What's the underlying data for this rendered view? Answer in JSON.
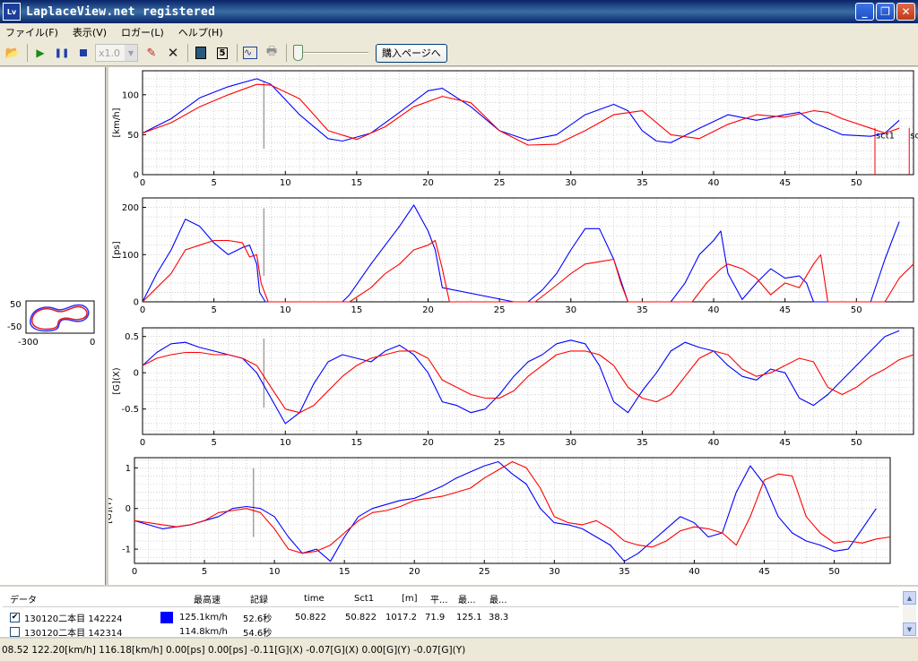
{
  "window": {
    "title": "LaplaceView.net registered",
    "icon_label": "Lv"
  },
  "menu": [
    "ファイル(F)",
    "表示(V)",
    "ロガー(L)",
    "ヘルプ(H)"
  ],
  "toolbar": {
    "speed_value": "x1.0",
    "buy_button": "購入ページへ",
    "playback_position": 0
  },
  "minimap": {
    "y_ticks": [
      "50",
      "-50"
    ],
    "x_ticks": [
      "-300",
      "0"
    ]
  },
  "colors": {
    "series1": "#0000ff",
    "series2": "#ff0000",
    "cursor": "#a0a0a0",
    "grid": "#b8b8b8"
  },
  "chart_data": [
    {
      "type": "line",
      "ylabel": "[km/h]",
      "ylim": [
        0,
        130
      ],
      "yticks": [
        "0",
        "50",
        "100"
      ],
      "xlim": [
        0,
        54
      ],
      "xticks": [
        "0",
        "5",
        "10",
        "15",
        "20",
        "25",
        "30",
        "35",
        "40",
        "45",
        "50"
      ],
      "cursor_x": 8.5,
      "annotations": [
        {
          "text": "sct1",
          "x": 51.3
        },
        {
          "text": "sct",
          "x": 53.7
        }
      ],
      "series": [
        {
          "x": [
            0,
            2,
            4,
            6,
            8,
            9,
            11,
            13,
            14,
            16,
            18,
            20,
            21,
            23,
            25,
            27,
            29,
            31,
            33,
            34,
            35,
            36,
            37,
            39,
            41,
            43,
            45,
            46,
            47,
            49,
            51,
            52,
            53
          ],
          "values": [
            52,
            70,
            96,
            110,
            120,
            113,
            75,
            45,
            42,
            52,
            78,
            105,
            108,
            85,
            55,
            43,
            50,
            75,
            88,
            80,
            55,
            42,
            40,
            58,
            75,
            68,
            75,
            78,
            65,
            50,
            48,
            52,
            68
          ]
        },
        {
          "x": [
            0,
            2,
            4,
            6,
            8,
            9,
            11,
            13,
            15,
            17,
            19,
            21,
            23,
            25,
            27,
            29,
            31,
            33,
            35,
            37,
            39,
            41,
            43,
            45,
            47,
            48,
            49,
            51,
            52,
            53
          ],
          "values": [
            52,
            65,
            85,
            100,
            113,
            112,
            95,
            55,
            44,
            60,
            85,
            98,
            90,
            55,
            37,
            38,
            55,
            75,
            80,
            50,
            45,
            63,
            75,
            72,
            80,
            78,
            70,
            58,
            52,
            58
          ]
        }
      ]
    },
    {
      "type": "line",
      "ylabel": "[ps]",
      "ylim": [
        0,
        220
      ],
      "yticks": [
        "0",
        "100",
        "200"
      ],
      "xlim": [
        0,
        54
      ],
      "xticks": [
        "0",
        "5",
        "10",
        "15",
        "20",
        "25",
        "30",
        "35",
        "40",
        "45",
        "50"
      ],
      "cursor_x": 8.5,
      "series": [
        {
          "x": [
            0,
            1,
            2,
            3,
            4,
            5,
            6,
            7,
            7.5,
            8,
            8.2,
            8.6,
            14,
            14.5,
            16,
            17,
            18,
            19,
            20,
            20.5,
            21,
            26,
            27,
            28,
            29,
            30,
            31,
            32,
            33,
            34,
            37,
            38,
            39,
            40,
            40.5,
            41,
            42,
            43,
            44,
            45,
            46,
            46.5,
            47,
            48,
            51,
            52,
            53
          ],
          "values": [
            0,
            60,
            110,
            175,
            160,
            125,
            100,
            115,
            120,
            80,
            20,
            0,
            0,
            15,
            80,
            120,
            160,
            205,
            150,
            110,
            30,
            0,
            0,
            25,
            60,
            110,
            155,
            155,
            90,
            0,
            0,
            40,
            100,
            130,
            150,
            60,
            5,
            40,
            70,
            50,
            55,
            40,
            0,
            0,
            0,
            90,
            170
          ]
        },
        {
          "x": [
            0,
            1,
            2,
            3,
            4,
            5,
            6,
            7,
            7.5,
            8,
            8.3,
            8.8,
            14.5,
            16,
            17,
            18,
            19,
            20,
            20.5,
            21,
            21.5,
            27.5,
            29,
            30,
            31,
            32,
            33,
            33.5,
            34,
            38.5,
            39.5,
            40.5,
            41,
            42,
            43,
            44,
            45,
            46,
            47,
            47.5,
            48,
            52,
            53,
            54
          ],
          "values": [
            0,
            30,
            60,
            110,
            120,
            130,
            130,
            125,
            95,
            100,
            40,
            0,
            0,
            30,
            60,
            80,
            110,
            120,
            130,
            70,
            0,
            0,
            35,
            60,
            80,
            85,
            90,
            40,
            0,
            0,
            40,
            70,
            80,
            70,
            50,
            15,
            40,
            30,
            80,
            100,
            0,
            0,
            50,
            80
          ]
        }
      ]
    },
    {
      "type": "line",
      "ylabel": "[G](X)",
      "ylim": [
        -0.85,
        0.62
      ],
      "yticks": [
        "-0.5",
        "0",
        "0.5"
      ],
      "xlim": [
        0,
        54
      ],
      "xticks": [
        "0",
        "5",
        "10",
        "15",
        "20",
        "25",
        "30",
        "35",
        "40",
        "45",
        "50"
      ],
      "cursor_x": 8.5,
      "series": [
        {
          "x": [
            0,
            1,
            2,
            3,
            4,
            5,
            6,
            7,
            8,
            9,
            10,
            11,
            12,
            13,
            14,
            15,
            16,
            17,
            18,
            19,
            20,
            21,
            22,
            23,
            24,
            25,
            26,
            27,
            28,
            29,
            30,
            31,
            32,
            33,
            34,
            35,
            36,
            37,
            38,
            39,
            40,
            41,
            42,
            43,
            44,
            45,
            46,
            47,
            48,
            49,
            50,
            51,
            52,
            53
          ],
          "values": [
            0.1,
            0.28,
            0.4,
            0.42,
            0.35,
            0.3,
            0.25,
            0.2,
            0.0,
            -0.35,
            -0.7,
            -0.55,
            -0.15,
            0.15,
            0.25,
            0.2,
            0.15,
            0.3,
            0.38,
            0.25,
            0.0,
            -0.4,
            -0.45,
            -0.55,
            -0.5,
            -0.3,
            -0.05,
            0.15,
            0.25,
            0.4,
            0.45,
            0.4,
            0.1,
            -0.4,
            -0.55,
            -0.25,
            0.0,
            0.3,
            0.42,
            0.35,
            0.3,
            0.1,
            -0.05,
            -0.1,
            0.05,
            0.0,
            -0.35,
            -0.45,
            -0.3,
            -0.1,
            0.1,
            0.3,
            0.5,
            0.58
          ]
        },
        {
          "x": [
            0,
            1,
            2,
            3,
            4,
            5,
            6,
            7,
            8,
            9,
            10,
            11,
            12,
            13,
            14,
            15,
            16,
            17,
            18,
            19,
            20,
            21,
            22,
            23,
            24,
            25,
            26,
            27,
            28,
            29,
            30,
            31,
            32,
            33,
            34,
            35,
            36,
            37,
            38,
            39,
            40,
            41,
            42,
            43,
            44,
            45,
            46,
            47,
            48,
            49,
            50,
            51,
            52,
            53,
            54
          ],
          "values": [
            0.1,
            0.2,
            0.25,
            0.28,
            0.28,
            0.25,
            0.25,
            0.2,
            0.1,
            -0.2,
            -0.5,
            -0.55,
            -0.45,
            -0.25,
            -0.05,
            0.1,
            0.2,
            0.25,
            0.3,
            0.3,
            0.2,
            -0.1,
            -0.2,
            -0.3,
            -0.35,
            -0.35,
            -0.25,
            -0.05,
            0.1,
            0.25,
            0.3,
            0.3,
            0.25,
            0.1,
            -0.2,
            -0.35,
            -0.4,
            -0.3,
            -0.05,
            0.2,
            0.3,
            0.25,
            0.05,
            -0.05,
            0.0,
            0.1,
            0.2,
            0.15,
            -0.2,
            -0.3,
            -0.2,
            -0.05,
            0.05,
            0.18,
            0.25
          ]
        }
      ]
    },
    {
      "type": "line",
      "ylabel": "[G](Y)",
      "ylim": [
        -1.35,
        1.25
      ],
      "yticks": [
        "-1",
        "0",
        "1"
      ],
      "xlim": [
        0,
        54
      ],
      "xticks": [
        "0",
        "5",
        "10",
        "15",
        "20",
        "25",
        "30",
        "35",
        "40",
        "45",
        "50"
      ],
      "cursor_x": 8.5,
      "series": [
        {
          "x": [
            0,
            1,
            2,
            3,
            4,
            5,
            6,
            7,
            8,
            9,
            10,
            11,
            12,
            13,
            14,
            15,
            16,
            17,
            18,
            19,
            20,
            21,
            22,
            23,
            24,
            25,
            26,
            27,
            28,
            29,
            30,
            31,
            32,
            33,
            34,
            35,
            36,
            37,
            38,
            39,
            40,
            41,
            42,
            43,
            44,
            45,
            46,
            47,
            48,
            49,
            50,
            51,
            52,
            53
          ],
          "values": [
            -0.3,
            -0.4,
            -0.5,
            -0.45,
            -0.4,
            -0.3,
            -0.2,
            0.0,
            0.05,
            0.0,
            -0.2,
            -0.7,
            -1.1,
            -1.0,
            -1.3,
            -0.7,
            -0.2,
            0.0,
            0.1,
            0.2,
            0.25,
            0.4,
            0.55,
            0.75,
            0.9,
            1.05,
            1.15,
            0.85,
            0.6,
            0.0,
            -0.35,
            -0.4,
            -0.5,
            -0.7,
            -0.9,
            -1.3,
            -1.1,
            -0.8,
            -0.5,
            -0.2,
            -0.35,
            -0.7,
            -0.6,
            0.4,
            1.05,
            0.6,
            -0.2,
            -0.6,
            -0.8,
            -0.9,
            -1.05,
            -1.0,
            -0.5,
            0.0
          ]
        },
        {
          "x": [
            0,
            1,
            2,
            3,
            4,
            5,
            6,
            7,
            8,
            9,
            10,
            11,
            12,
            13,
            14,
            15,
            16,
            17,
            18,
            19,
            20,
            21,
            22,
            23,
            24,
            25,
            26,
            27,
            28,
            29,
            30,
            31,
            32,
            33,
            34,
            35,
            36,
            37,
            38,
            39,
            40,
            41,
            42,
            43,
            44,
            45,
            46,
            47,
            48,
            49,
            50,
            51,
            52,
            53,
            54
          ],
          "values": [
            -0.3,
            -0.35,
            -0.4,
            -0.45,
            -0.4,
            -0.3,
            -0.1,
            -0.05,
            0.0,
            -0.1,
            -0.5,
            -1.0,
            -1.1,
            -1.05,
            -0.9,
            -0.6,
            -0.3,
            -0.1,
            -0.05,
            0.05,
            0.2,
            0.25,
            0.3,
            0.4,
            0.5,
            0.75,
            0.95,
            1.15,
            1.0,
            0.5,
            -0.2,
            -0.35,
            -0.4,
            -0.3,
            -0.5,
            -0.8,
            -0.9,
            -0.95,
            -0.8,
            -0.55,
            -0.45,
            -0.5,
            -0.6,
            -0.9,
            -0.2,
            0.7,
            0.85,
            0.8,
            -0.2,
            -0.6,
            -0.85,
            -0.8,
            -0.85,
            -0.75,
            -0.7
          ]
        }
      ]
    }
  ],
  "table": {
    "headers": [
      "データ",
      "",
      "最高速",
      "記録",
      "time",
      "Sct1",
      "[m]",
      "平...",
      "最...",
      "最..."
    ],
    "rows": [
      {
        "checked": true,
        "name": "130120二本目 142224",
        "color": "#0000ff",
        "max_speed": "125.1km/h",
        "record": "52.6秒",
        "time": "50.822",
        "sct1": "50.822",
        "distance": "1017.2",
        "avg": "71.9",
        "max": "125.1",
        "min": "38.3"
      },
      {
        "checked": false,
        "name": "130120二本目 142314",
        "color": "",
        "max_speed": "114.8km/h",
        "record": "54.6秒",
        "time": "",
        "sct1": "",
        "distance": "",
        "avg": "",
        "max": "",
        "min": ""
      }
    ]
  },
  "status": "08.52 122.20[km/h] 116.18[km/h]  0.00[ps] 0.00[ps]  -0.11[G](X) -0.07[G](X)  0.00[G](Y) -0.07[G](Y)"
}
